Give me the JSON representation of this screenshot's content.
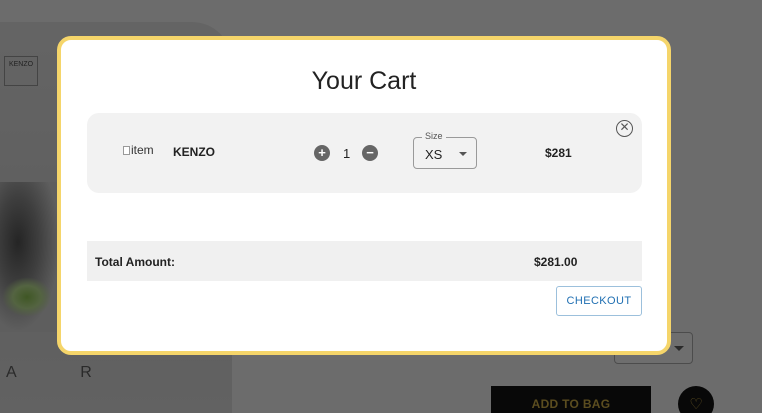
{
  "background": {
    "tag_text": "KENZO",
    "hoodie_letters": "A R",
    "add_to_bag_label": "ADD TO BAG",
    "favorite_icon": "heart-icon"
  },
  "modal": {
    "title": "Your Cart",
    "items": [
      {
        "image_alt": "item",
        "name": "KENZO",
        "quantity": "1",
        "size_label": "Size",
        "size_value": "XS",
        "price": "$281"
      }
    ],
    "total_label": "Total Amount:",
    "total_value": "$281.00",
    "checkout_label": "CHECKOUT"
  },
  "colors": {
    "modal_border": "#f5d56a",
    "checkout_text": "#1f6fb2",
    "add_to_bag_bg": "#111111",
    "add_to_bag_text": "#b79a3f"
  }
}
